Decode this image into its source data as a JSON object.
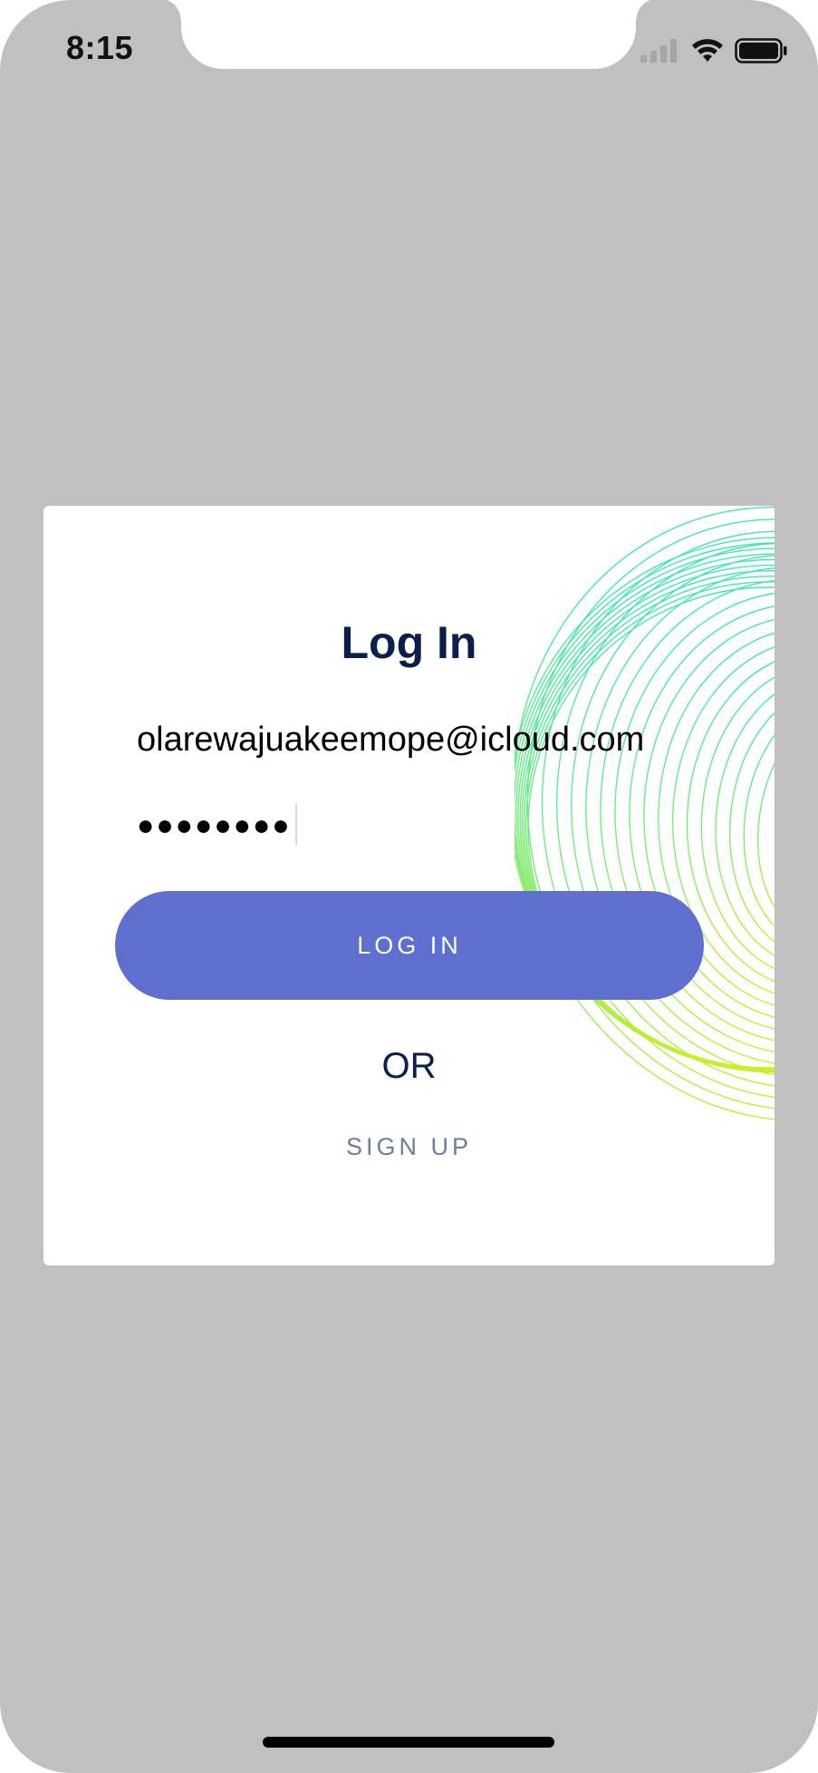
{
  "status_bar": {
    "time": "8:15",
    "icons": [
      "signal-icon",
      "wifi-icon",
      "battery-icon"
    ]
  },
  "login_card": {
    "title": "Log In",
    "email_value": "olarewajuakeemope@icloud.com",
    "password_masked": "●●●●●●●●",
    "login_button_label": "LOG IN",
    "or_label": "OR",
    "signup_label": "SIGN UP"
  },
  "colors": {
    "background": "#c0c0c0",
    "card": "#ffffff",
    "title": "#0c1e4b",
    "button": "#5e6fd0",
    "signup": "#6e7d9b",
    "decoration_start": "#2ee6c4",
    "decoration_end": "#c8ef2a"
  }
}
